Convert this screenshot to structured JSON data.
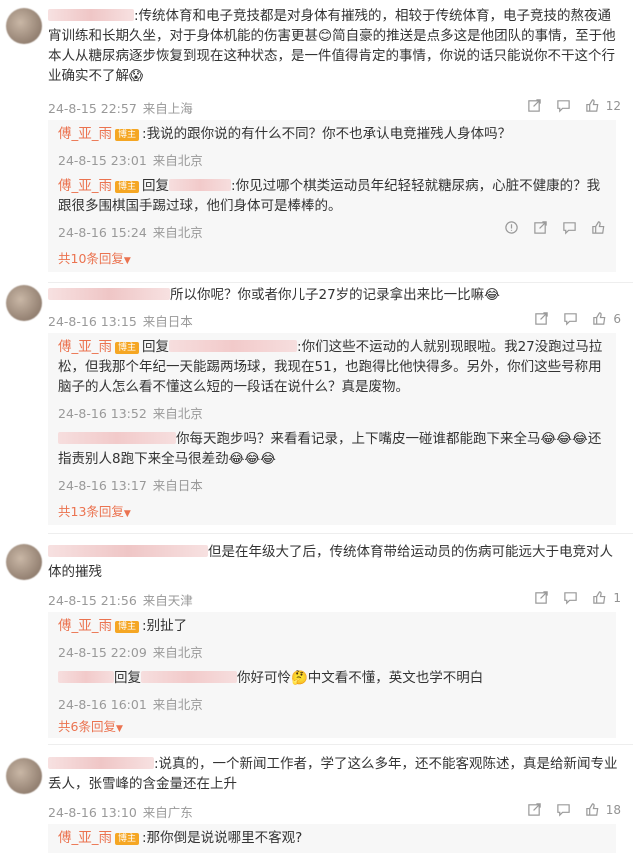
{
  "labels": {
    "badge": "博主",
    "reply_prefix": "回复",
    "colon": ":"
  },
  "threads": [
    {
      "text": ":传统体育和电子竞技都是对身体有摧残的，相较于传统体育，电子竞技的熬夜通宵训练和长期久坐，对于身体机能的伤害更甚😊简自豪的推送是点多这是他团队的事情，至于他本人从糖尿病逐步恢复到现在这种状态，是一件值得肯定的事情，你说的话只能说你不干这个行业确实不了解😱",
      "time": "24-8-15 22:57",
      "location": "来自上海",
      "likes": "12",
      "replies": [
        {
          "name": "傅_亚_雨",
          "text": ":我说的跟你说的有什么不同？你不也承认电竞摧残人身体吗？",
          "time": "24-8-15 23:01",
          "location": "来自北京"
        },
        {
          "name": "傅_亚_雨",
          "text": ":你见过哪个棋类运动员年纪轻轻就糖尿病，心脏不健康的？我跟很多围棋国手踢过球，他们身体可是棒棒的。",
          "time": "24-8-16 15:24",
          "location": "来自北京"
        }
      ],
      "more": "共10条回复"
    },
    {
      "text": "所以你呢？你或者你儿子27岁的记录拿出来比一比嘛😂",
      "time": "24-8-16 13:15",
      "location": "来自日本",
      "likes": "6",
      "replies": [
        {
          "name": "傅_亚_雨",
          "text": ":你们这些不运动的人就别现眼啦。我27没跑过马拉松，但我那个年纪一天能踢两场球，我现在51，也跑得比他快得多。另外，你们这些号称用脑子的人怎么看不懂这么短的一段话在说什么？真是废物。",
          "time": "24-8-16 13:52",
          "location": "来自北京"
        },
        {
          "name": "",
          "text": "你每天跑步吗？来看看记录，上下嘴皮一碰谁都能跑下来全马😂😂😂还指责别人8跑下来全马很差劲😂😂😂",
          "time": "24-8-16 13:17",
          "location": "来自日本"
        }
      ],
      "more": "共13条回复"
    },
    {
      "text": "但是在年级大了后，传统体育带给运动员的伤病可能远大于电竞对人体的摧残",
      "time": "24-8-15 21:56",
      "location": "来自天津",
      "likes": "1",
      "replies": [
        {
          "name": "傅_亚_雨",
          "text": ":别扯了",
          "time": "24-8-15 22:09",
          "location": "来自北京"
        },
        {
          "name": "",
          "text": "你好可怜🤔中文看不懂，英文也学不明白",
          "time": "24-8-16 16:01",
          "location": "来自北京"
        }
      ],
      "more": "共6条回复"
    },
    {
      "text": ":说真的，一个新闻工作者，学了这么多年，还不能客观陈述，真是给新闻专业丢人，张雪峰的含金量还在上升",
      "time": "24-8-16 13:10",
      "location": "来自广东",
      "likes": "18",
      "replies": [
        {
          "name": "傅_亚_雨",
          "text": ":那你倒是说说哪里不客观?",
          "time": "",
          "location": ""
        }
      ]
    }
  ],
  "icons": [
    "share-icon",
    "comment-icon",
    "like-icon",
    "report-icon"
  ]
}
